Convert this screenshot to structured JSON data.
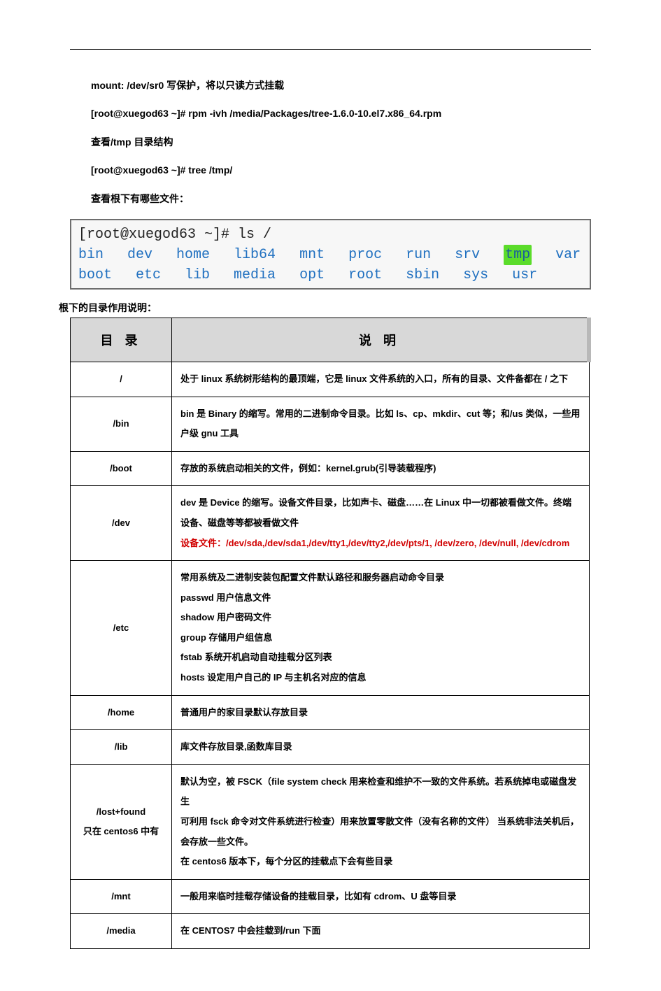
{
  "lines": {
    "l1": "mount: /dev/sr0  写保护，将以只读方式挂载",
    "l2": "[root@xuegod63 ~]# rpm  -ivh  /media/Packages/tree-1.6.0-10.el7.x86_64.rpm",
    "l3": "查看/tmp 目录结构",
    "l4": "[root@xuegod63 ~]# tree   /tmp/",
    "l5": "查看根下有哪些文件："
  },
  "terminal": {
    "prompt": "[root@xuegod63 ~]# ls /",
    "row1": [
      "bin",
      "dev",
      "home",
      "lib64",
      "mnt",
      "proc",
      "run",
      "srv",
      "tmp",
      "var"
    ],
    "row2": [
      "boot",
      "etc",
      "lib",
      "media",
      "opt",
      "root",
      "sbin",
      "sys",
      "usr"
    ],
    "highlight": "tmp"
  },
  "intro": "根下的目录作用说明：",
  "table": {
    "headers": {
      "c1": "目 录",
      "c2": "说  明"
    },
    "rows": [
      {
        "dir": "/",
        "desc": "处于 linux 系统树形结构的最顶端，它是 linux 文件系统的入口，所有的目录、文件备都在 / 之下"
      },
      {
        "dir": "/bin",
        "desc": "bin 是 Binary 的缩写。常用的二进制命令目录。比如 ls、cp、mkdir、cut 等；和/us 类似，一些用户级 gnu 工具"
      },
      {
        "dir": "/boot",
        "desc": "存放的系统启动相关的文件，例如：kernel.grub(引导装载程序)"
      },
      {
        "dir": "/dev",
        "desc_plain": "dev 是 Device 的缩写。设备文件目录，比如声卡、磁盘……在 Linux 中一切都被看做文件。终端设备、磁盘等等都被看做文件",
        "desc_red": "设备文件：/dev/sda,/dev/sda1,/dev/tty1,/dev/tty2,/dev/pts/1, /dev/zero, /dev/null, /dev/cdrom"
      },
      {
        "dir": "/etc",
        "desc_lines": [
          "常用系统及二进制安装包配置文件默认路径和服务器启动命令目录",
          "passwd  用户信息文件",
          "shadow   用户密码文件",
          "group  存储用户组信息",
          "fstab  系统开机启动自动挂载分区列表",
          "hosts  设定用户自己的 IP 与主机名对应的信息"
        ]
      },
      {
        "dir": "/home",
        "desc": "普通用户的家目录默认存放目录"
      },
      {
        "dir": "/lib",
        "desc": "库文件存放目录,函数库目录"
      },
      {
        "dir_lines": [
          "/lost+found",
          "只在 centos6 中有"
        ],
        "desc_lines": [
          "默认为空，被 FSCK（file system check 用来检查和维护不一致的文件系统。若系统掉电或磁盘发生",
          "可利用 fsck 命令对文件系统进行检查）用来放置零散文件（没有名称的文件） 当系统非法关机后，",
          "会存放一些文件。",
          "在 centos6 版本下，每个分区的挂载点下会有些目录"
        ],
        "small": true
      },
      {
        "dir": "/mnt",
        "desc": "一般用来临时挂载存储设备的挂载目录，比如有 cdrom、U 盘等目录"
      },
      {
        "dir": "/media",
        "desc": "在 CENTOS7 中会挂载到/run 下面"
      }
    ]
  }
}
